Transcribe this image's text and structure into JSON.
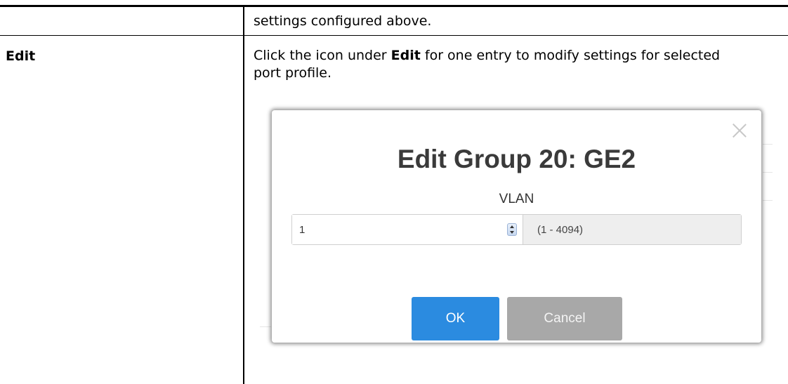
{
  "doc": {
    "continued_text": "settings configured above.",
    "term": "Edit",
    "description_parts": {
      "part1": "Click the icon under ",
      "bold": "Edit",
      "part2": " for one entry to modify settings for selected port profile."
    }
  },
  "dialog": {
    "title": "Edit Group 20: GE2",
    "field_label": "VLAN",
    "vlan_value": "1",
    "range_hint": "(1 - 4094)",
    "ok_label": "OK",
    "cancel_label": "Cancel",
    "close_icon": "close-icon",
    "spinner_icon": "spinner-icon"
  }
}
